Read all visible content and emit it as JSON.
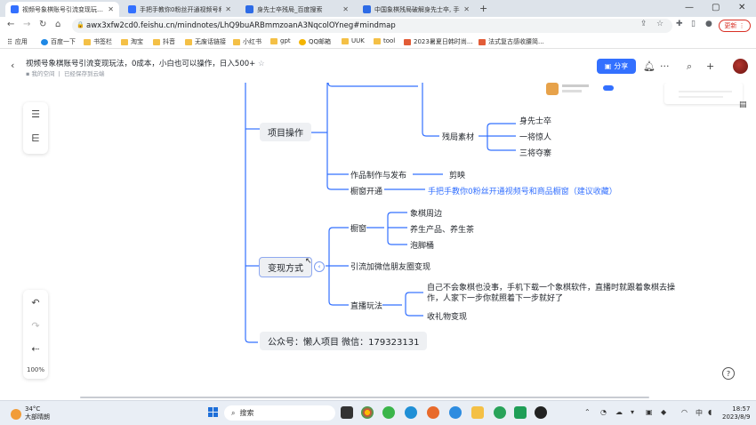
{
  "browser": {
    "tabs": [
      {
        "label": "视频号象棋账号引流变现玩法, 0成",
        "active": true,
        "favicon_color": "#3370ff"
      },
      {
        "label": "手把手教你0粉丝开通视频号和商",
        "active": false,
        "favicon_color": "#3370ff"
      },
      {
        "label": "身先士卒残局_百度搜索",
        "active": false,
        "favicon_color": "#2d6be6"
      },
      {
        "label": "中国象棋残局破解身先士卒, 手把",
        "active": false,
        "favicon_color": "#2d6be6"
      }
    ],
    "new_tab": "+",
    "url": "awx3xfw2cd0.feishu.cn/mindnotes/LhQ9buARBmmzoanA3NqcolOYneg#mindmap",
    "update_label": "更新",
    "bookmarks": [
      "应用",
      "百度一下",
      "书签栏",
      "淘宝",
      "抖音",
      "无废话链接",
      "小红书",
      "gpt",
      "QQ邮箱",
      "UUK",
      "tool",
      "2023暑夏日韩时尚...",
      "法式复古感收腰简..."
    ]
  },
  "app": {
    "title": "视频号象棋账号引流变现玩法，0成本，小白也可以操作，日入500+",
    "subtitle_location": "我的空间",
    "subtitle_status": "已经保存到云端",
    "share_label": "分享",
    "zoom": "100%",
    "colors": {
      "accent": "#3370ff",
      "line": "#3370ff"
    }
  },
  "mindmap": {
    "project_ops": "项目操作",
    "endgame_material": "残局素材",
    "endgame_items": [
      "身先士卒",
      "一将惊人",
      "三将夺寨"
    ],
    "works_publish": "作品制作与发布",
    "jianying": "剪映",
    "showcase_open": "橱窗开通",
    "showcase_link": "手把手教你0粉丝开通视频号和商品橱窗（建议收藏）",
    "monetize": "变现方式",
    "showcase": "橱窗",
    "showcase_items": [
      "象棋周边",
      "养生产品、养生茶",
      "泡脚桶"
    ],
    "wechat_traffic": "引流加微信朋友圈变现",
    "live_play": "直播玩法",
    "live_items": [
      "自己不会象棋也没事，手机下载一个象棋软件，直播时就跟着象棋去操作，人家下一步你就照着下一步就好了",
      "收礼物变现"
    ],
    "contact": "公众号：懒人项目  微信：179323131",
    "toggle_symbol": "‹"
  },
  "taskbar": {
    "temp": "34°C",
    "weather": "大部晴朗",
    "search": "搜索",
    "time": "18:57",
    "date": "2023/8/9",
    "lang": "中"
  }
}
